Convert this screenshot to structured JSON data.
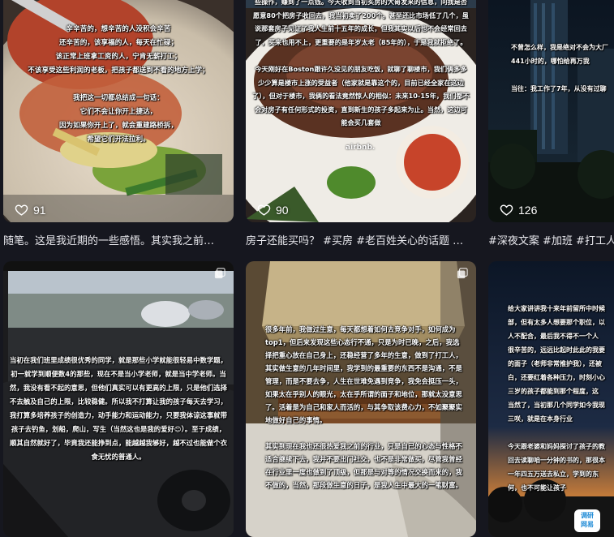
{
  "feed": {
    "posts": [
      {
        "overlay": "辛辛苦的，想辛苦的人没积会辛苦\n还辛苦的，该享福的人，每天在忙碌；\n该正常上班拿工资的人，宁肯无薪打工；\n不该享受这些利润的老板，把孩子都送到不看的地方上学；\n\n我把这一切都总结成一句话：\n它们不会让你开上捷达，\n因为如果你开上了，就会重建路桥拆，\n希望它们开法拉利。",
        "likes": "91",
        "caption": "随笔。这是我近期的一些感悟。其实我之前…"
      },
      {
        "overlay": "些操作，赚到了一点钱。今天收到当初买房的大哥发来的信息，问我是否愿意80个把房子收回去，我当初卖了200个。甚至还比市场低了几个，虽说那套房子见证了我人生前十五年的成长，但我其实以后也不会经常回去了，买来也用不上，更重要的是年岁太老（85年的），于是我就拒绝了。\n\n今天刚好在Boston跟许久没见的朋友吃饭，就聊了聊楼市，我们俩多多少少算是楼市上涨的受益者（他家就是靠这个的，目前已经全家在这边了），但对于楼市，我俩的看法竟然惊人的相似：未来10-15年，我们都不会对房子有任何形式的投资，直到新生的孩子多起来为止。当然，这边可能会买几套做",
        "watermark": "airbnb.",
        "likes": "90",
        "caption": "房子还能买吗？ #买房 #老百姓关心的话题 …"
      },
      {
        "overlay": "不曾怎么样，我是绝对不会为大厂\n441小时的，哪怕给再万我\n\n当往：我工作了7年，从没有过聊\n",
        "likes": "126",
        "caption": "#深夜文案 #加班 #打工人"
      },
      {
        "overlay": "当初在我们班里成绩很优秀的同学，就是那些小学就能很轻易中数学题，初一就学到顺便数4的那些，现在不是当小学老师，就是当中学老师。当然，我没有看不起的意思，但他们真实可以有更高的上限，只是他们选择不去触及自己的上限，比较稳健。所以我不打算让我的孩子每天去学习，我打算多培养孩子的创造力，动手能力和运动能力，只要我体谅这事就带孩子去钓鱼，划船，爬山，写生（当然这也是我的爱好😊）。至于成绩，顺其自然就好了，毕竟我还能挣到点，能越越我够好，越不过也能做个衣食无忧的普通人。"
      },
      {
        "overlay": "很多年前，我做过生意，每天都想着如何去竞争对手，如何成为top1，但后来发现这些心态行不通，只是为时已晚，之后，我选择把重心放在自己身上，还稳经营了多年的生意，做到了打工人，其实做生意的几年时间里，我学到的最重要的东西不是沟通，不是管理，而是不要去争，人生在世难免遇到竞争，我免会挺压一头，如果太在乎别人的眼光，太在乎所谓的面子和地位，那就太没意思了。活着是为自己和家人而活的，与其争取该费心力，不如聚聚实地做好自己的事情。\n\n其实到现在我也还很热爱我之前的行业，只是自己的心态与性格不适合继续下去，我并不要出门社交，也不是非常做买，尽管我曾经在行业里一度也做到了顶级，但那是与对等的情况交换而来的，我不做的，当然，那段做生意的日子，是我人生中最大的一笔财富。"
      },
      {
        "overlay": "给大家讲讲我十来年前留所中时候\n部，但有太多人想要那个职位，以\n人不配合，最后我不得不一个人\n很辛苦的，远远比起时此此的我要\n的面子（老师非常推护我），还被\n白，还要红着各种压力，时刻小心\n三岁的孩子都能到那个程度，这\n当然了，当初那几个同学如今我现\n三咲，就是在本身行业\n\n今天跟老婆和妈妈探讨了孩子的教\n回去读聊咱一分钟的书的，那很本\n一年四五万送去私立，学到的东\n何，也不可能让孩子",
        "logo": "调研\n网易"
      }
    ]
  },
  "colors": {
    "background": "#16171f",
    "text": "#e9e9ee"
  },
  "icons": {
    "like": "heart-outline-icon",
    "multi_image": "multi-image-icon"
  }
}
